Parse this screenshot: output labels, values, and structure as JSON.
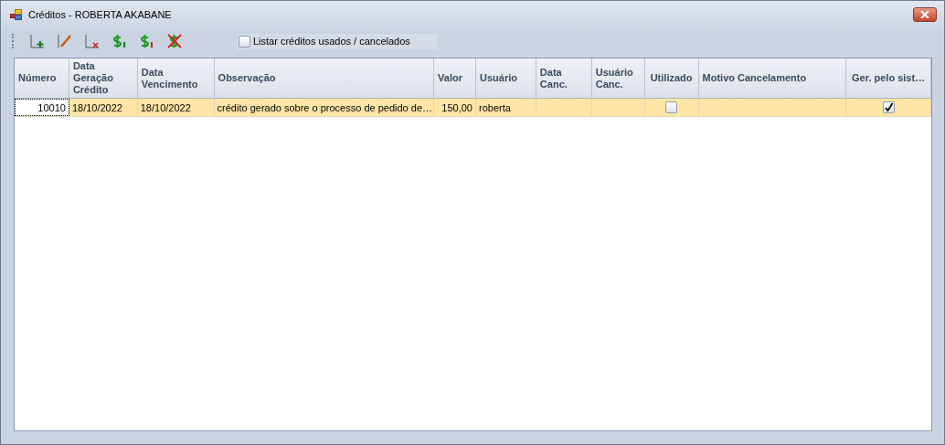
{
  "window": {
    "title": "Créditos - ROBERTA AKABANE"
  },
  "toolbar": {
    "buttons": [
      {
        "kind": "add"
      },
      {
        "kind": "edit"
      },
      {
        "kind": "delete"
      },
      {
        "kind": "money-up"
      },
      {
        "kind": "money-down"
      },
      {
        "kind": "money-cancel"
      }
    ],
    "filter": {
      "label": "Listar créditos usados / cancelados",
      "checked": false
    }
  },
  "table": {
    "columns": [
      {
        "label": "Número",
        "kind": "number"
      },
      {
        "label": "Data Geração Crédito"
      },
      {
        "label": "Data Vencimento"
      },
      {
        "label": "Observação"
      },
      {
        "label": "Valor",
        "kind": "number"
      },
      {
        "label": "Usuário"
      },
      {
        "label": "Data Canc."
      },
      {
        "label": "Usuário Canc."
      },
      {
        "label": "Utilizado",
        "kind": "check"
      },
      {
        "label": "Motivo Cancelamento"
      },
      {
        "label": "Ger. pelo sist…",
        "kind": "check"
      }
    ],
    "rows": [
      {
        "selected": true,
        "cells": [
          {
            "text": "10010"
          },
          {
            "text": "18/10/2022"
          },
          {
            "text": "18/10/2022"
          },
          {
            "text": "crédito gerado sobre o processo de pedido de…"
          },
          {
            "text": "150,00"
          },
          {
            "text": "roberta"
          },
          {},
          {},
          {
            "checked": false
          },
          {},
          {
            "checked": true
          }
        ]
      }
    ]
  }
}
